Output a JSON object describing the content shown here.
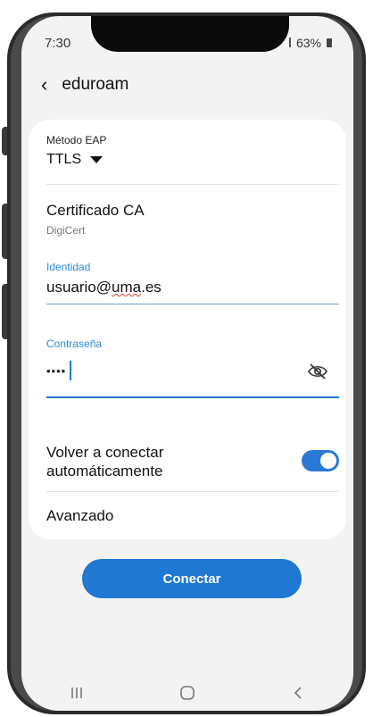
{
  "status": {
    "time": "7:30",
    "battery": "63%"
  },
  "header": {
    "back_icon": "chevron-left-icon",
    "title": "eduroam"
  },
  "form": {
    "eap_label": "Método EAP",
    "eap_value": "TTLS",
    "ca_label": "Certificado CA",
    "ca_value": "DigiCert",
    "identity_label": "Identidad",
    "identity_value_user": "usuario@",
    "identity_value_domain": "uma",
    "identity_value_tld": ".es",
    "password_label": "Contraseña",
    "password_value": "••••",
    "password_toggle_icon": "eye-off-icon",
    "reconnect_label_line1": "Volver a conectar",
    "reconnect_label_line2": "automáticamente",
    "reconnect_enabled": true,
    "advanced_label": "Avanzado"
  },
  "actions": {
    "connect_label": "Conectar"
  },
  "navbar": {
    "recents_icon": "recents-icon",
    "home_icon": "home-icon",
    "back_icon": "back-nav-icon"
  },
  "colors": {
    "accent": "#1f78d1",
    "label_blue": "#2a8ad8",
    "background": "#f3f3f3"
  }
}
